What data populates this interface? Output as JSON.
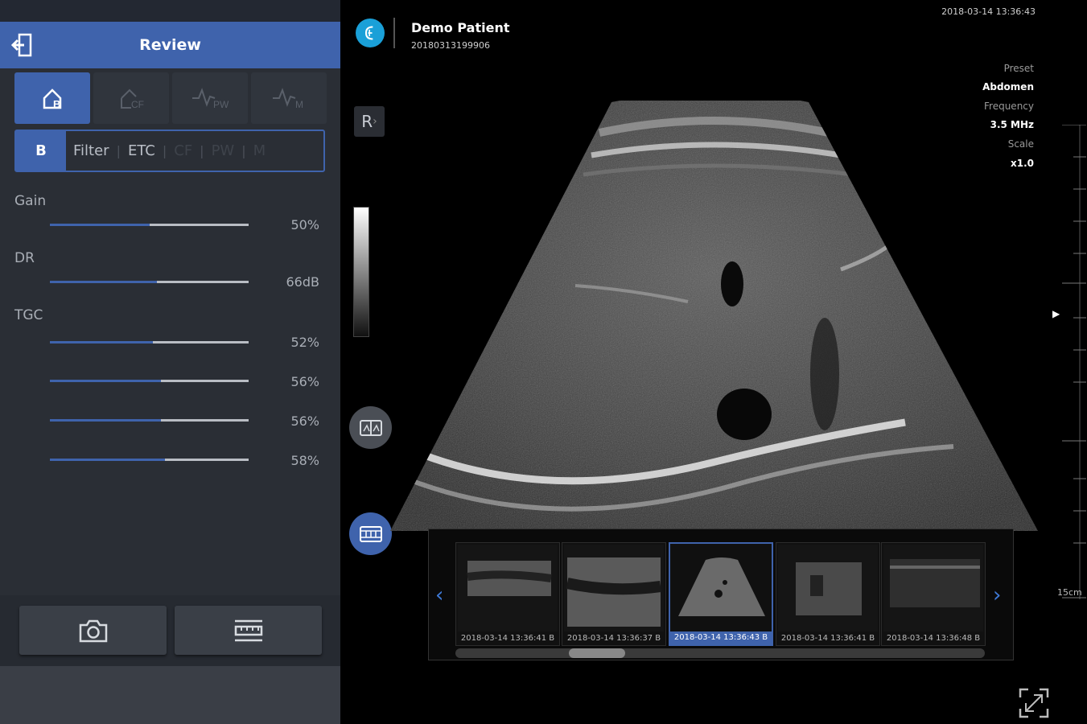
{
  "header": {
    "title": "Review"
  },
  "modes": [
    {
      "label": "B",
      "active": true
    },
    {
      "label": "CF",
      "active": false
    },
    {
      "label": "PW",
      "active": false
    },
    {
      "label": "M",
      "active": false
    }
  ],
  "subtabs": {
    "b": "B",
    "filter": "Filter",
    "etc": "ETC",
    "cf": "CF",
    "pw": "PW",
    "m": "M"
  },
  "params": {
    "gain": {
      "label": "Gain",
      "value": "50%",
      "level": 0.5
    },
    "dr": {
      "label": "DR",
      "value": "66dB",
      "level": 0.54
    },
    "tgc": {
      "label": "TGC"
    },
    "tgc1": {
      "value": "52%",
      "level": 0.52
    },
    "tgc2": {
      "value": "56%",
      "level": 0.56
    },
    "tgc3": {
      "value": "56%",
      "level": 0.56
    },
    "tgc4": {
      "value": "58%",
      "level": 0.58
    }
  },
  "patient": {
    "name": "Demo  Patient",
    "id": "20180313199906"
  },
  "datetime": "2018-03-14 13:36:43",
  "scan_info": {
    "preset_label": "Preset",
    "preset_value": "Abdomen",
    "frequency_label": "Frequency",
    "frequency_value": "3.5 MHz",
    "scale_label": "Scale",
    "scale_value": "x1.0"
  },
  "orientation": "R",
  "depth": "15cm",
  "thumbnails": [
    {
      "caption": "2018-03-14 13:36:41 B",
      "selected": false
    },
    {
      "caption": "2018-03-14 13:36:37 B",
      "selected": false
    },
    {
      "caption": "2018-03-14 13:36:43 B",
      "selected": true
    },
    {
      "caption": "2018-03-14 13:36:41 B",
      "selected": false
    },
    {
      "caption": "2018-03-14 13:36:48 B",
      "selected": false
    }
  ],
  "colors": {
    "accent": "#3f63ac",
    "panel": "#2a2e35",
    "logo": "#1aa0d8"
  }
}
